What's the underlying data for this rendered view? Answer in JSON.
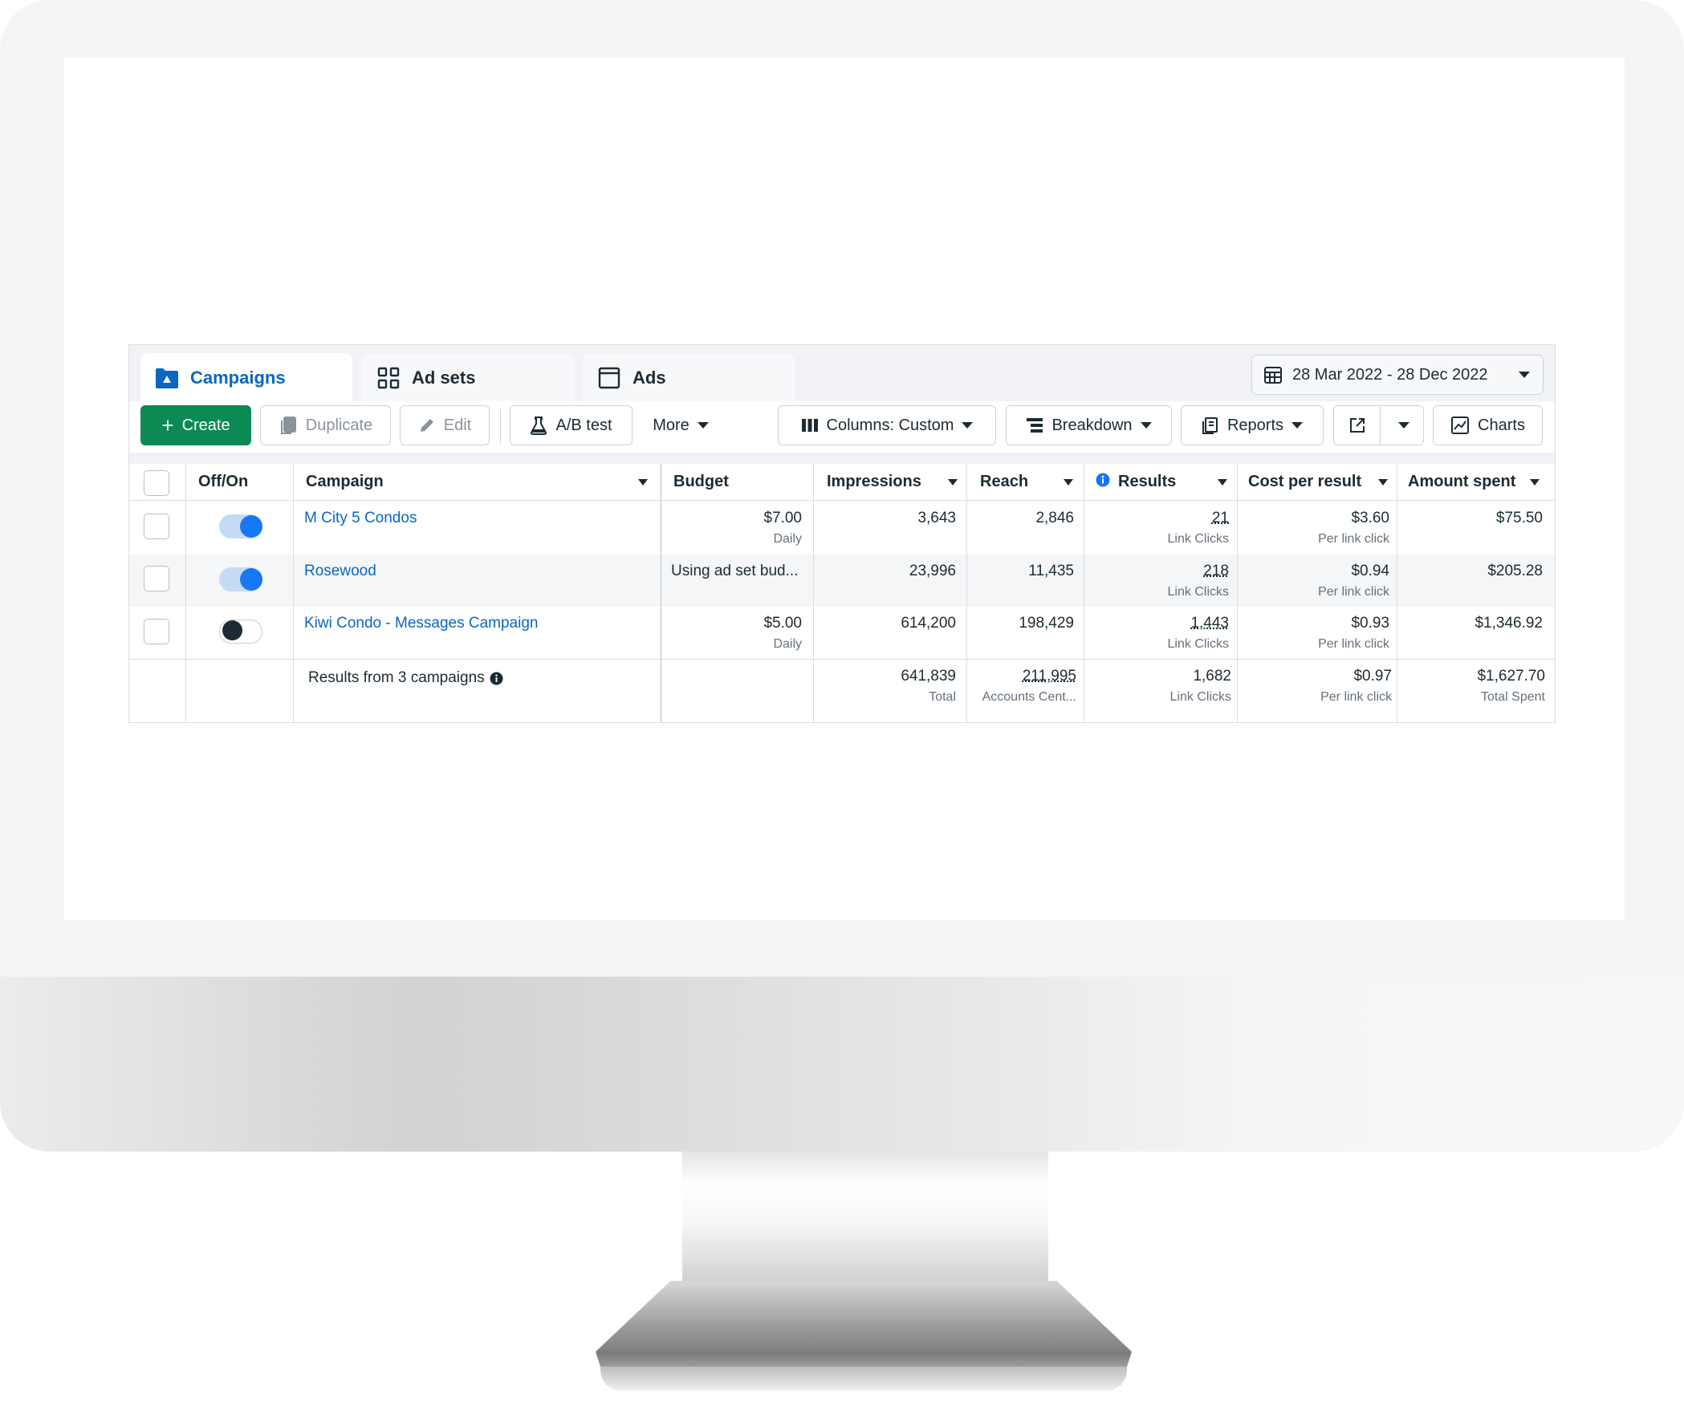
{
  "tabs": [
    {
      "label": "Campaigns",
      "icon": "folder-icon"
    },
    {
      "label": "Ad sets",
      "icon": "grid-icon"
    },
    {
      "label": "Ads",
      "icon": "ad-window-icon"
    }
  ],
  "date_range": "28 Mar 2022 - 28 Dec 2022",
  "toolbar": {
    "create": "Create",
    "duplicate": "Duplicate",
    "edit": "Edit",
    "ab_test": "A/B test",
    "more": "More",
    "columns": "Columns: Custom",
    "breakdown": "Breakdown",
    "reports": "Reports",
    "charts": "Charts"
  },
  "columns": {
    "off_on": "Off/On",
    "campaign": "Campaign",
    "budget": "Budget",
    "impressions": "Impressions",
    "reach": "Reach",
    "results": "Results",
    "cost_per_result": "Cost per result",
    "amount_spent": "Amount spent"
  },
  "rows": [
    {
      "enabled": true,
      "campaign": "M City 5 Condos",
      "budget": "$7.00",
      "budget_sub": "Daily",
      "impressions": "3,643",
      "reach": "2,846",
      "results": "21",
      "results_sub": "Link Clicks",
      "cpr": "$3.60",
      "cpr_sub": "Per link click",
      "spent": "$75.50"
    },
    {
      "enabled": true,
      "campaign": "Rosewood",
      "budget": "Using ad set bud...",
      "budget_sub": "",
      "impressions": "23,996",
      "reach": "11,435",
      "results": "218",
      "results_sub": "Link Clicks",
      "cpr": "$0.94",
      "cpr_sub": "Per link click",
      "spent": "$205.28"
    },
    {
      "enabled": false,
      "campaign": "Kiwi Condo - Messages Campaign",
      "budget": "$5.00",
      "budget_sub": "Daily",
      "impressions": "614,200",
      "reach": "198,429",
      "results": "1,443",
      "results_sub": "Link Clicks",
      "cpr": "$0.93",
      "cpr_sub": "Per link click",
      "spent": "$1,346.92"
    }
  ],
  "totals": {
    "label": "Results from 3 campaigns",
    "impressions": "641,839",
    "impressions_sub": "Total",
    "reach": "211,995",
    "reach_sub": "Accounts Cent...",
    "results": "1,682",
    "results_sub": "Link Clicks",
    "cpr": "$0.97",
    "cpr_sub": "Per link click",
    "spent": "$1,627.70",
    "spent_sub": "Total Spent"
  },
  "colors": {
    "accent": "#0a66c2",
    "create_button": "#0b8a54",
    "toggle_on": "#1877f2"
  }
}
